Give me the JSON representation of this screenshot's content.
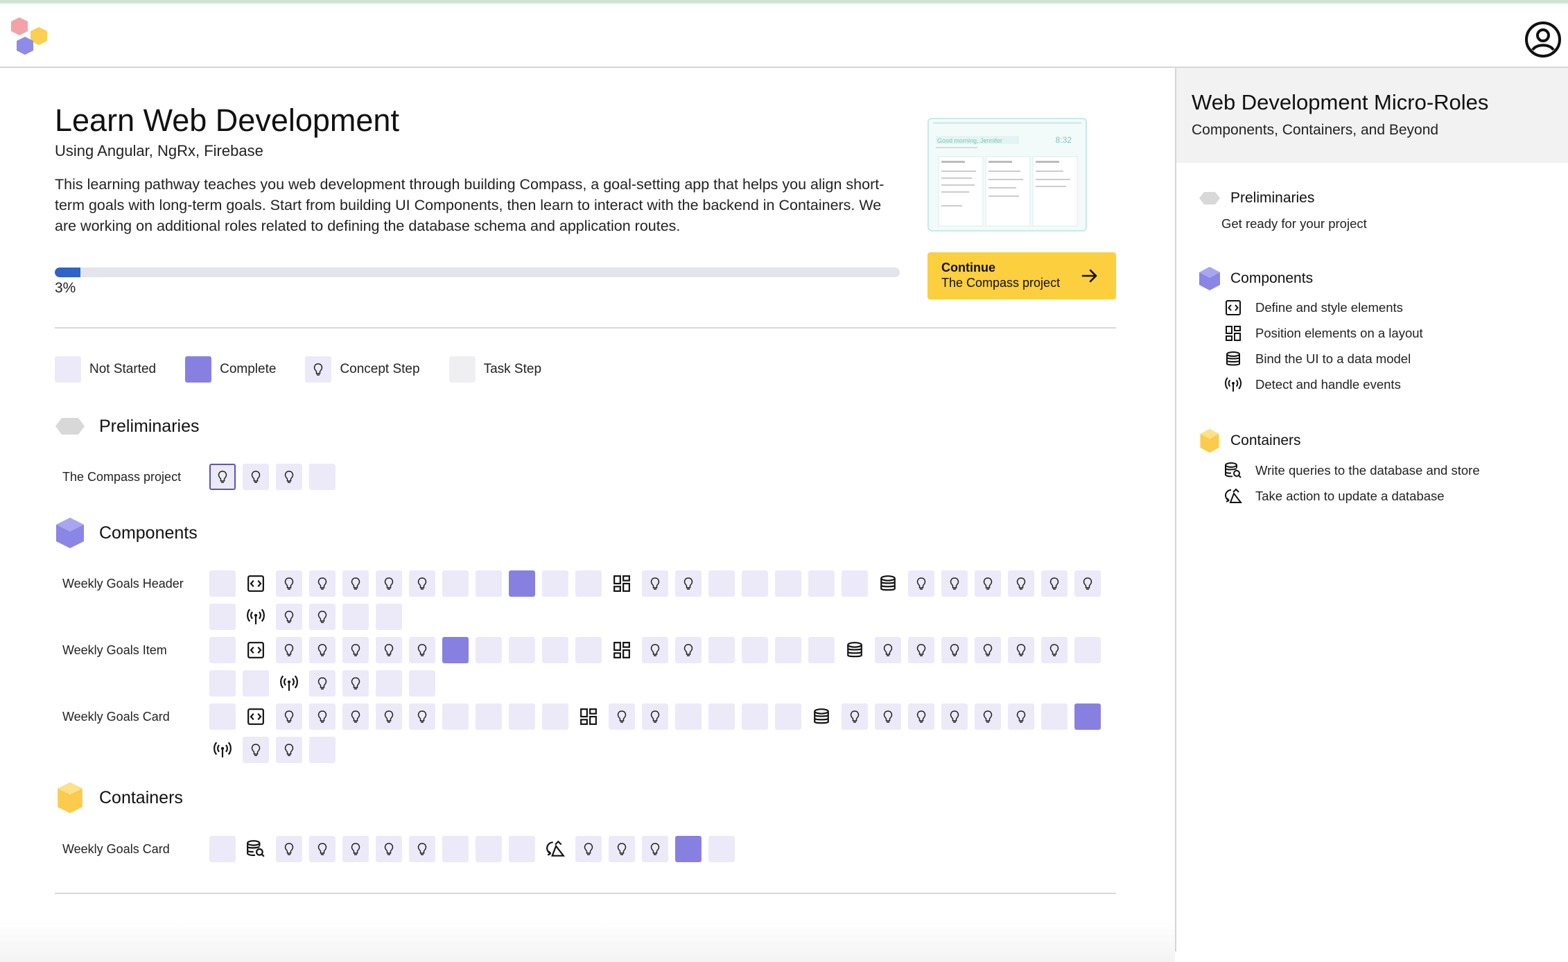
{
  "app": {
    "logo": "hexagons-logo",
    "account_icon": "account-circle-icon"
  },
  "course": {
    "title": "Learn Web Development",
    "subtitle": "Using Angular, NgRx, Firebase",
    "description": "This learning pathway teaches you web development through building Compass, a goal-setting app that helps you align short-term goals with long-term goals. Start from building UI Components, then learn to interact with the backend in Containers. We are working on additional roles related to defining the database schema and application routes.",
    "progress_percent": 3,
    "progress_label": "3%",
    "preview_greeting": "Good morning, Jennifer",
    "preview_time": "8:32",
    "continue_label": "Continue",
    "continue_project": "The Compass project"
  },
  "legend": [
    {
      "label": "Not Started",
      "kind": "not-started"
    },
    {
      "label": "Complete",
      "kind": "complete"
    },
    {
      "label": "Concept Step",
      "kind": "concept"
    },
    {
      "label": "Task Step",
      "kind": "task"
    }
  ],
  "sections": {
    "preliminaries": {
      "title": "Preliminaries",
      "color": "#d8d8d8"
    },
    "components": {
      "title": "Components",
      "color": "#8a86e6"
    },
    "containers": {
      "title": "Containers",
      "color": "#fbcb4c"
    }
  },
  "rows": [
    {
      "label": "The Compass project",
      "tiles": "BCCN"
    },
    {
      "label": "Weekly Goals Header",
      "tiles": "NECCCCCNNXNNLCCNNNNNDCCCCCCNACCNN"
    },
    {
      "label": "Weekly Goals Item",
      "tiles": "NECCCCCXNNNNLCCNNNNDCCCCCCNNNACCNN"
    },
    {
      "label": "Weekly Goals Card",
      "tiles": "NECCCCCNNNNLCCNNNNDCCCCCCNXACCN"
    },
    {
      "label": "Weekly Goals Card",
      "tiles": "NQCCCCCNNNUCCCXN"
    }
  ],
  "sidebar": {
    "title": "Web Development Micro-Roles",
    "subtitle": "Components, Containers, and Beyond",
    "preliminaries": {
      "label": "Preliminaries",
      "item": "Get ready for your project"
    },
    "components": {
      "label": "Components",
      "items": [
        {
          "icon": "code-box-icon",
          "label": "Define and style elements"
        },
        {
          "icon": "layout-grid-icon",
          "label": "Position elements on a layout"
        },
        {
          "icon": "database-icon",
          "label": "Bind the UI to a data model"
        },
        {
          "icon": "antenna-icon",
          "label": "Detect and handle events"
        }
      ]
    },
    "containers": {
      "label": "Containers",
      "items": [
        {
          "icon": "database-search-icon",
          "label": "Write queries to the database and store"
        },
        {
          "icon": "update-action-icon",
          "label": "Take action to update a database"
        }
      ]
    }
  }
}
